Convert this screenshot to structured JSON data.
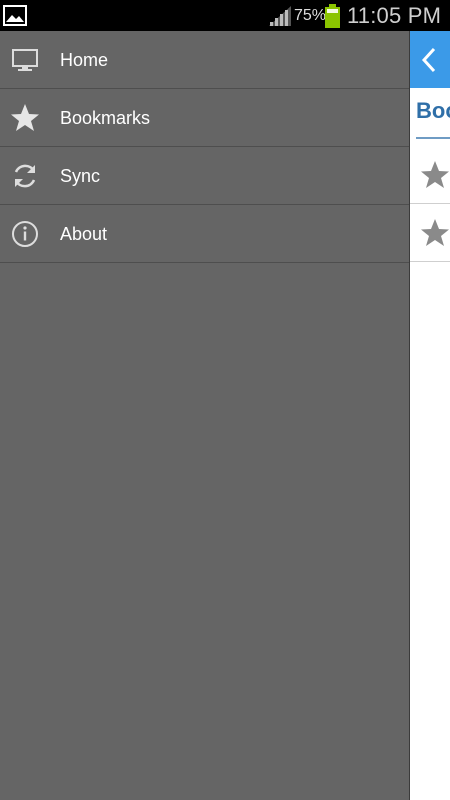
{
  "status_bar": {
    "battery_percent": "75%",
    "time": "11:05 PM",
    "icons": [
      "gallery-icon",
      "signal-icon",
      "battery-icon"
    ],
    "battery_color": "#8bc400"
  },
  "drawer": {
    "background": "#656565",
    "items": [
      {
        "label": "Home",
        "icon": "monitor-icon"
      },
      {
        "label": "Bookmarks",
        "icon": "star-icon"
      },
      {
        "label": "Sync",
        "icon": "sync-icon"
      },
      {
        "label": "About",
        "icon": "info-icon"
      }
    ]
  },
  "content": {
    "action_bar_color": "#3b9ae8",
    "title": "Bookmarks",
    "rows": [
      {
        "icon": "star-icon"
      },
      {
        "icon": "star-icon"
      }
    ]
  }
}
